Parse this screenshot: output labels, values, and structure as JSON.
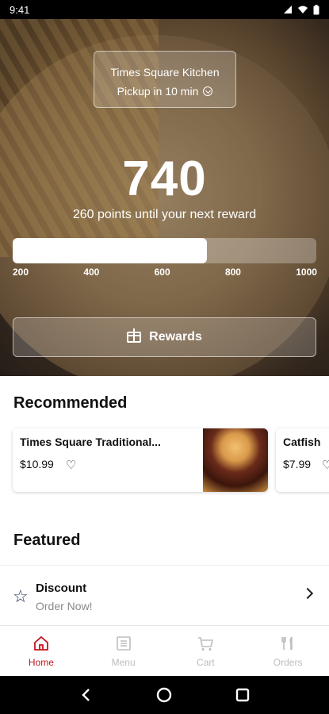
{
  "status_bar": {
    "time": "9:41"
  },
  "hero": {
    "store_name": "Times Square Kitchen",
    "pickup_label": "Pickup in 10 min",
    "points": "740",
    "points_subtitle": "260 points until your next reward",
    "progress_fraction": 0.64,
    "tick_labels": [
      "200",
      "400",
      "600",
      "800",
      "1000"
    ],
    "rewards_button": "Rewards"
  },
  "recommended": {
    "title": "Recommended",
    "items": [
      {
        "name": "Times Square Traditional...",
        "price": "$10.99"
      },
      {
        "name": "Catfish",
        "price": "$7.99"
      }
    ]
  },
  "featured": {
    "title": "Featured",
    "discount_title": "Discount",
    "discount_subtitle": "Order Now!"
  },
  "bottom_nav": {
    "items": [
      {
        "label": "Home",
        "icon": "home-icon",
        "active": true
      },
      {
        "label": "Menu",
        "icon": "menu-icon",
        "active": false
      },
      {
        "label": "Cart",
        "icon": "cart-icon",
        "active": false
      },
      {
        "label": "Orders",
        "icon": "orders-icon",
        "active": false
      }
    ]
  },
  "colors": {
    "accent": "#c4161c",
    "inactive": "#bdbdbd",
    "star": "#1a2a55"
  }
}
